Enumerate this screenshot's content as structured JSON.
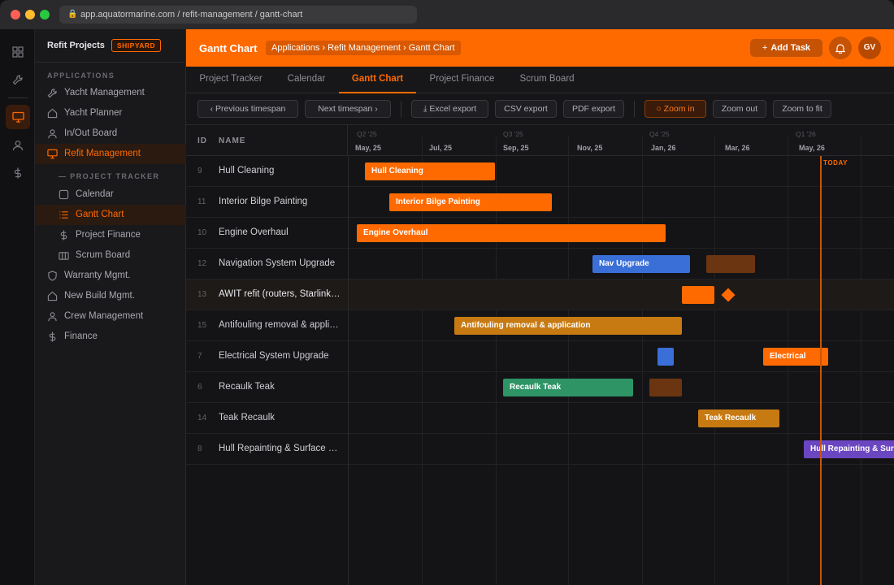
{
  "browser": {
    "url": "app.aquatormarine.com / refit-management / gantt-chart"
  },
  "sidebar": {
    "title": "Refit Projects",
    "badge": "SHIPYARD",
    "section_label": "APPLICATIONS",
    "subsection_label": "— PROJECT TRACKER",
    "items": [
      {
        "label": "Yacht Management",
        "icon": "wrench-icon"
      },
      {
        "label": "Yacht Planner",
        "icon": "home-icon"
      },
      {
        "label": "In/Out Board",
        "icon": "user-icon"
      },
      {
        "label": "Refit Management",
        "icon": "monitor-icon",
        "active": true
      },
      {
        "label": "Calendar",
        "icon": "square-icon",
        "sub": true
      },
      {
        "label": "Gantt Chart",
        "icon": "list-icon",
        "sub": true,
        "active": true
      },
      {
        "label": "Project Finance",
        "icon": "dollar-icon",
        "sub": true
      },
      {
        "label": "Scrum Board",
        "icon": "board-icon",
        "sub": true
      },
      {
        "label": "Warranty Mgmt.",
        "icon": "shield-icon"
      },
      {
        "label": "New Build Mgmt.",
        "icon": "home-icon"
      },
      {
        "label": "Crew Management",
        "icon": "user-icon"
      },
      {
        "label": "Finance",
        "icon": "dollar-icon"
      }
    ]
  },
  "header": {
    "title": "Gantt Chart",
    "breadcrumb": "Applications › Refit Management › Gantt Chart",
    "add_task": "Add Task",
    "avatar": "GV"
  },
  "tabs": [
    "Project Tracker",
    "Calendar",
    "Gantt Chart",
    "Project Finance",
    "Scrum Board"
  ],
  "active_tab": "Gantt Chart",
  "toolbar": {
    "prev": "Previous timespan",
    "next": "Next timespan",
    "excel": "Excel export",
    "csv": "CSV export",
    "pdf": "PDF export",
    "zoom_in": "Zoom in",
    "zoom_out": "Zoom out",
    "zoom_fit": "Zoom to fit"
  },
  "columns": {
    "id": "ID",
    "name": "NAME"
  },
  "timeline": {
    "quarters": [
      "Q2 '25",
      "Q3 '25",
      "Q4 '25",
      "Q1 '26"
    ],
    "months": [
      "May, 25",
      "Jul, 25",
      "Sep, 25",
      "Nov, 25",
      "Jan, 26",
      "Mar, 26",
      "May, 26"
    ],
    "today_label": "TODAY"
  },
  "tasks": [
    {
      "id": "9",
      "name": "Hull Cleaning",
      "bar_label": "Hull Cleaning",
      "color": "#ff6a00"
    },
    {
      "id": "11",
      "name": "Interior Bilge Painting",
      "bar_label": "Interior Bilge Painting",
      "color": "#ff6a00"
    },
    {
      "id": "10",
      "name": "Engine Overhaul",
      "bar_label": "Engine Overhaul",
      "color": "#ff6a00"
    },
    {
      "id": "12",
      "name": "Navigation System Upgrade",
      "bar_label": "Nav Upgrade",
      "color": "#3a6fd8"
    },
    {
      "id": "13",
      "name": "AWIT refit (routers, Starlink, ...",
      "bar_label": "",
      "color": "#ff6a00"
    },
    {
      "id": "15",
      "name": "Antifouling removal & application",
      "bar_label": "Antifouling removal & application",
      "color": "#c77a12"
    },
    {
      "id": "7",
      "name": "Electrical System Upgrade",
      "bar_label": "Electrical",
      "color": "#ff6a00"
    },
    {
      "id": "6",
      "name": "Recaulk Teak",
      "bar_label": "Recaulk Teak",
      "color": "#2e9466"
    },
    {
      "id": "14",
      "name": "Teak Recaulk",
      "bar_label": "Teak Recaulk",
      "color": "#c77a12"
    },
    {
      "id": "8",
      "name": "Hull Repainting & Surface Prep",
      "bar_label": "Hull Repainting & Surface Prep",
      "color": "#6b46c1"
    }
  ]
}
